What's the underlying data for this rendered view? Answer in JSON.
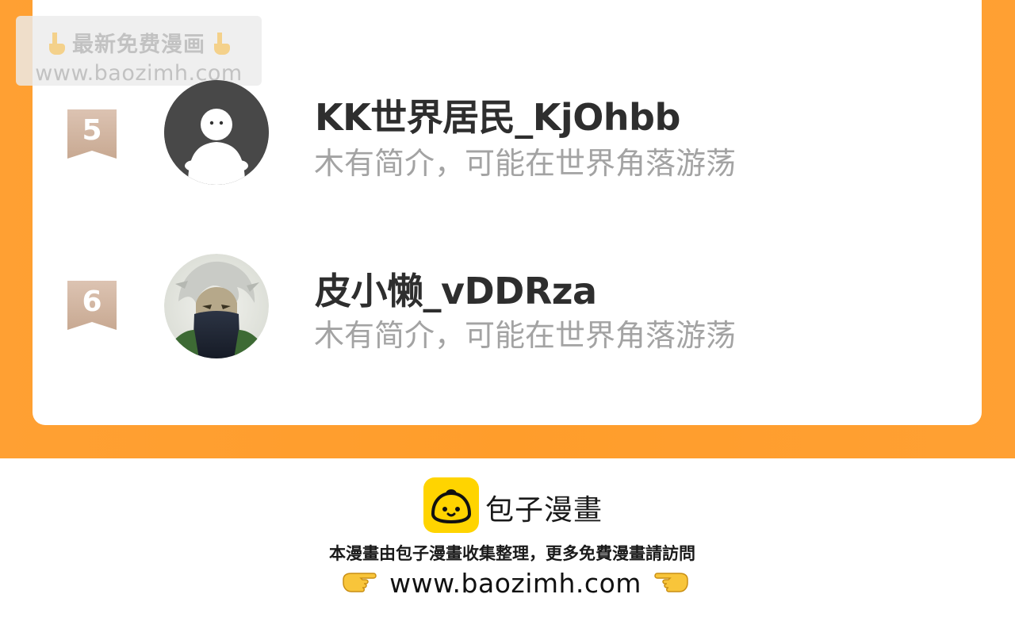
{
  "watermark": {
    "line1": "最新免费漫画",
    "line2": "www.baozimh.com",
    "emoji": "pointing-down-hand-icon"
  },
  "colors": {
    "orange_bg": "#ff9d2b",
    "card_bg": "#ffffff",
    "rank_badge": "#d2b6a3",
    "name_text": "#2e2e2e",
    "bio_text": "#a3a3a3",
    "brand_yellow": "#ffd400"
  },
  "ranking": {
    "entries": [
      {
        "rank": "5",
        "name": "KK世界居民_KjOhbb",
        "bio": "木有简介，可能在世界角落游荡",
        "avatar": "default-person-avatar-icon"
      },
      {
        "rank": "6",
        "name": "皮小懒_vDDRza",
        "bio": "木有简介，可能在世界角落游荡",
        "avatar": "anime-character-avatar"
      }
    ]
  },
  "footer": {
    "brand_name": "包子漫畫",
    "brand_logo": "baozi-bun-logo-icon",
    "note": "本漫畫由包子漫畫收集整理，更多免費漫畫請訪問",
    "url": "www.baozimh.com",
    "left_hand": "pointing-right-hand-icon",
    "right_hand": "pointing-left-hand-icon"
  }
}
